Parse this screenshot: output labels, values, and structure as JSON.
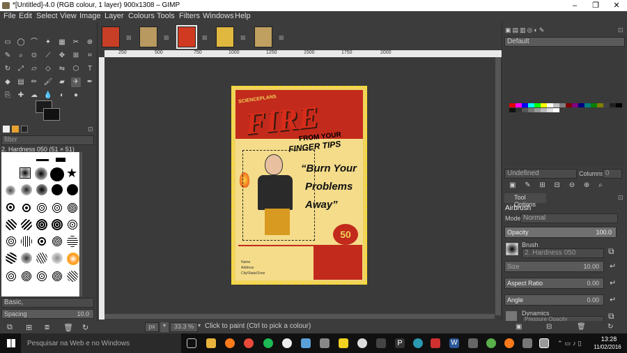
{
  "window": {
    "title": "*[Untitled]-4.0 (RGB colour, 1 layer) 900x1308 – GIMP",
    "minimize": "–",
    "maximize": "❐",
    "close": "✕"
  },
  "menu": [
    "File",
    "Edit",
    "Select",
    "View",
    "Image",
    "Layer",
    "Colours",
    "Tools",
    "Filters",
    "Windows",
    "Help"
  ],
  "toolbox": {
    "brush_filter_placeholder": "filter",
    "brush_name": "2. Hardness 050 (51 × 51)",
    "preset": "Basic,",
    "spacing_label": "Spacing",
    "spacing_value": "10.0"
  },
  "image_tabs": [
    {
      "close": "⊠"
    },
    {
      "close": "⊠"
    },
    {
      "close": "⊠"
    },
    {
      "close": "⊠"
    },
    {
      "close": "⊠"
    }
  ],
  "ruler_ticks": [
    "250",
    "500",
    "750",
    "1000",
    "1250",
    "1500",
    "1750",
    "2000"
  ],
  "poster": {
    "tagline": "SCIENCEPLANS",
    "title": "FIRE",
    "sub1": "FROM YOUR",
    "sub2": "FINGER TIPS",
    "quote1": "“Burn Your",
    "quote2": "Problems",
    "quote3": "Away”",
    "price": "50",
    "form1": "Name",
    "form2": "Address",
    "form3": "City/State/Zone"
  },
  "status": {
    "unit": "px",
    "zoom": "33.3 %",
    "message": "Click to paint (Ctrl to pick a colour)"
  },
  "right_dock": {
    "palette_name": "Default",
    "layer_mode": "Undefined",
    "columns_label": "Columns:",
    "columns_value": "0",
    "tool_options_tab": "Tool Options",
    "tool_name": "Airbrush",
    "mode_label": "Mode:",
    "mode_value": "Normal",
    "opacity_label": "Opacity",
    "opacity_value": "100.0",
    "brush_label": "Brush",
    "brush_value": "2. Hardness 050",
    "size_label": "Size",
    "size_value": "10.00",
    "aspect_label": "Aspect Ratio",
    "aspect_value": "0.00",
    "angle_label": "Angle",
    "angle_value": "0.00",
    "dynamics_label": "Dynamics",
    "dynamics_value": "Pressure Opacity"
  },
  "taskbar": {
    "search_placeholder": "Pesquisar na Web e no Windows",
    "time": "13:28",
    "date": "11/02/2016"
  },
  "colors": {
    "accent": "#f0d35a",
    "poster_red": "#c22a1c",
    "taskbar": "#101010"
  }
}
